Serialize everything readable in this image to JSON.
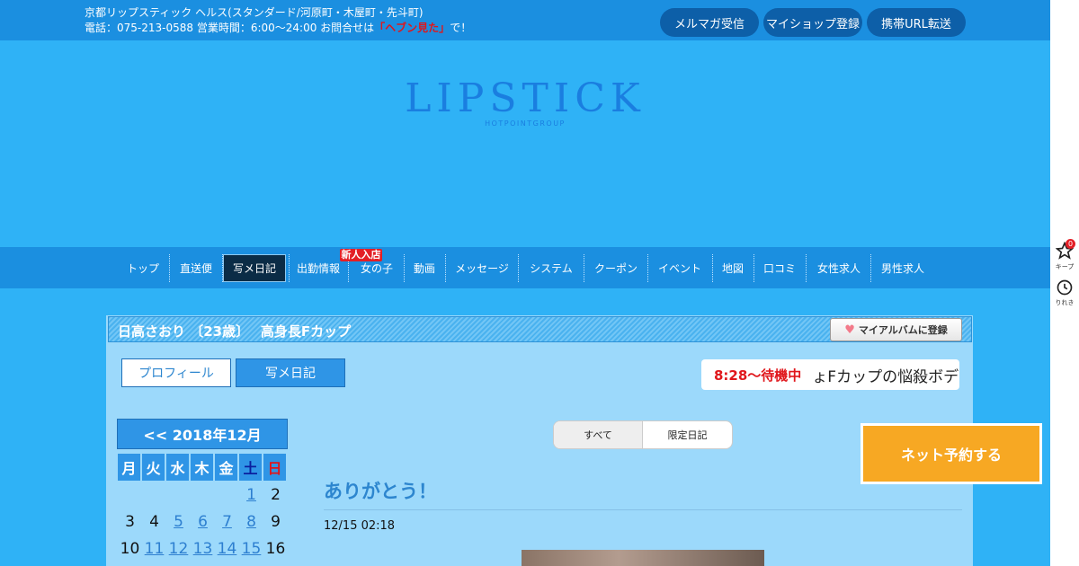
{
  "header": {
    "line1": "京都リップスティック ヘルス(スタンダード/河原町・木屋町・先斗町)",
    "line2_before": "電話：075-213-0588 営業時間：6:00～24:00 お問合せは",
    "line2_highlight": "「ヘブン見た」",
    "line2_after": "で！",
    "buttons": [
      "メルマガ受信",
      "マイショップ登録",
      "携帯URL転送"
    ]
  },
  "logo": {
    "title": "LIPSTICK",
    "subtitle": "HOTPOINTGROUP"
  },
  "nav": {
    "items": [
      "トップ",
      "直送便",
      "写メ日記",
      "出勤情報",
      "女の子",
      "動画",
      "メッセージ",
      "システム",
      "クーポン",
      "イベント",
      "地図",
      "口コミ",
      "女性求人",
      "男性求人"
    ],
    "active": "写メ日記",
    "badge": "新人入店"
  },
  "profile": {
    "name": "日高さおり 〔23歳〕　 高身長Fカップ",
    "album_button": "マイアルバムに登録",
    "tabs": [
      "プロフィール",
      "写メ日記"
    ],
    "status_time": "8:28～待機中",
    "status_catch": "ょFカップの悩殺ボデ"
  },
  "calendar": {
    "title": "<< 2018年12月",
    "weekdays": [
      "月",
      "火",
      "水",
      "木",
      "金",
      "土",
      "日"
    ],
    "rows": [
      [
        "",
        "",
        "",
        "",
        "",
        "1",
        "2"
      ],
      [
        "3",
        "4",
        "5",
        "6",
        "7",
        "8",
        "9"
      ],
      [
        "10",
        "11",
        "12",
        "13",
        "14",
        "15",
        "16"
      ]
    ],
    "linked_days": [
      "1",
      "5",
      "6",
      "7",
      "8",
      "11",
      "12",
      "13",
      "14",
      "15"
    ]
  },
  "filter": {
    "options": [
      "すべて",
      "限定日記"
    ],
    "selected": "すべて"
  },
  "post": {
    "title": "ありがとう！",
    "date": "12/15 02:18"
  },
  "reserve_label": "ネット予約する",
  "side": {
    "keep_label": "キープ",
    "keep_count": "0",
    "history_label": "りれき"
  },
  "colors": {
    "bg": "#2fb2f6",
    "bar": "#1b8fe0",
    "accent_red": "#e0161b",
    "reserve": "#f7a823"
  }
}
